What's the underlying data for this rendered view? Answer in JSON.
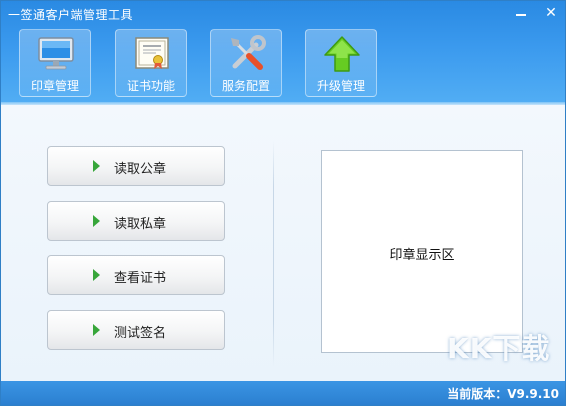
{
  "window": {
    "title": "一签通客户端管理工具"
  },
  "window_controls": {
    "minimize": "minimize-icon",
    "close_glyph": "✕"
  },
  "toolbar": {
    "items": [
      {
        "label": "印章管理",
        "icon": "monitor-icon"
      },
      {
        "label": "证书功能",
        "icon": "certificate-icon"
      },
      {
        "label": "服务配置",
        "icon": "tools-icon"
      },
      {
        "label": "升级管理",
        "icon": "upgrade-arrow-icon"
      }
    ]
  },
  "actions": [
    {
      "label": "读取公章"
    },
    {
      "label": "读取私章"
    },
    {
      "label": "查看证书"
    },
    {
      "label": "测试签名"
    }
  ],
  "display": {
    "label": "印章显示区"
  },
  "status": {
    "version": "当前版本：V9.9.10"
  },
  "watermark": {
    "text": "KK下载"
  },
  "colors": {
    "header": "#3b9aee",
    "arrow": "#37a63a",
    "status": "#2b7fd0"
  }
}
